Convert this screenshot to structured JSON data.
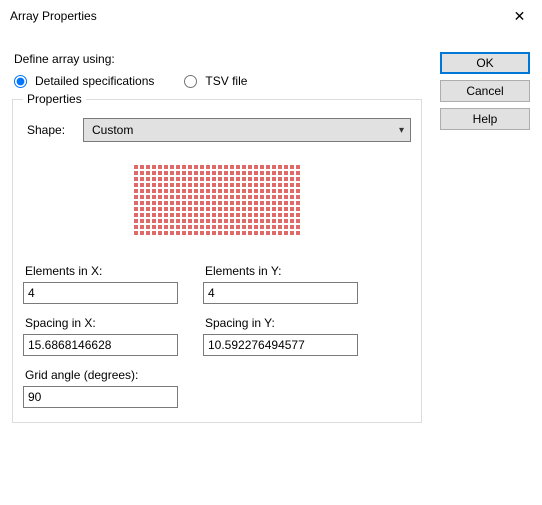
{
  "window": {
    "title": "Array Properties",
    "close_glyph": "✕"
  },
  "buttons": {
    "ok": "OK",
    "cancel": "Cancel",
    "help": "Help"
  },
  "intro": "Define array using:",
  "radios": {
    "detailed": "Detailed specifications",
    "tsv": "TSV file"
  },
  "group": {
    "legend": "Properties",
    "shape_label": "Shape:",
    "shape_value": "Custom"
  },
  "preview": {
    "rows": 12,
    "cols": 28
  },
  "fields": {
    "elements_x": {
      "label": "Elements in X:",
      "value": "4"
    },
    "elements_y": {
      "label": "Elements in Y:",
      "value": "4"
    },
    "spacing_x": {
      "label": "Spacing in X:",
      "value": "15.6868146628"
    },
    "spacing_y": {
      "label": "Spacing in Y:",
      "value": "10.592276494577"
    },
    "grid_angle": {
      "label": "Grid angle (degrees):",
      "value": "90"
    }
  }
}
